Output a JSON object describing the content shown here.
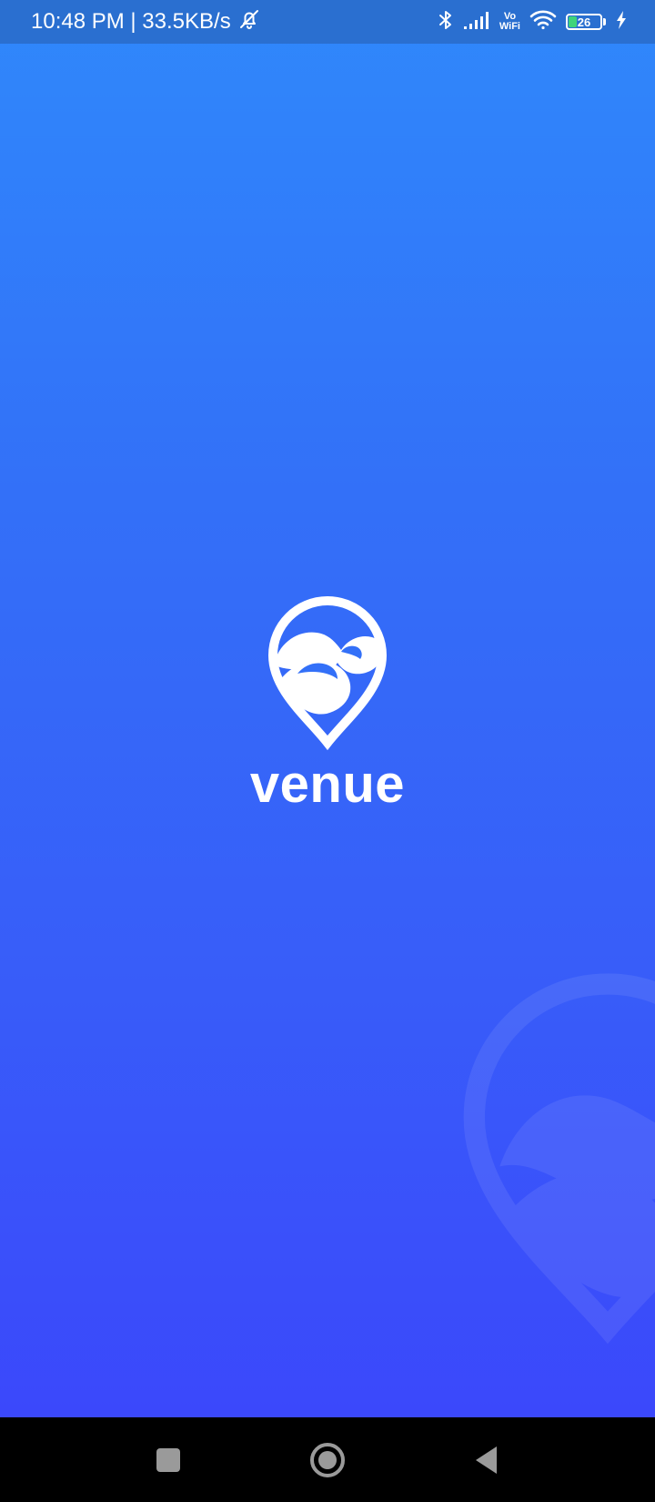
{
  "status_bar": {
    "time_speed": "10:48 PM | 33.5KB/s",
    "vo_top": "Vo",
    "vo_bottom": "WiFi",
    "battery_level": "26",
    "battery_fraction": 0.26,
    "icons": [
      "bell-off-icon",
      "bluetooth-icon",
      "signal-icon",
      "wifi-icon",
      "battery-icon",
      "charging-icon"
    ]
  },
  "app": {
    "name": "venue",
    "logo_icon": "venue-pin-logo"
  },
  "nav_bar": {
    "buttons": [
      "recents-square-icon",
      "home-circle-icon",
      "back-triangle-icon"
    ]
  },
  "colors": {
    "gradient_top": "#2f88fb",
    "gradient_bottom": "#3b48fb",
    "status_bar": "#2a6fd0",
    "battery_fill": "#3ed37a"
  }
}
